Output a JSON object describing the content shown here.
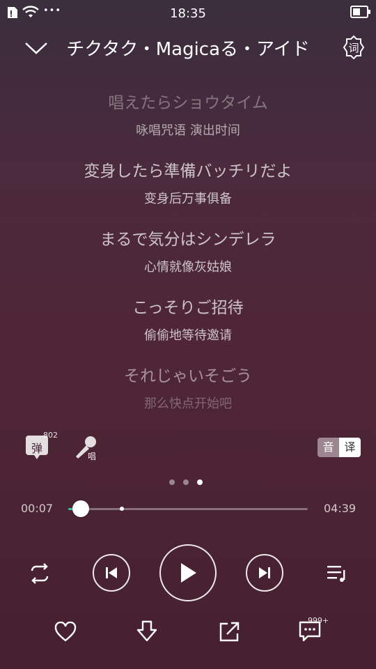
{
  "status_bar": {
    "time": "18:35",
    "more": "•••",
    "icons": [
      "sim-icon",
      "wifi-icon",
      "battery-icon"
    ]
  },
  "header": {
    "title": "チクタク・Magicaる・アイド",
    "settings_glyph": "词",
    "icons": [
      "chevron-down-icon",
      "lyrics-settings-icon"
    ]
  },
  "lyrics": [
    {
      "jp": "唱えたらショウタイム",
      "cn": "咏唱咒语 演出时间",
      "jp_opacity": 0.35,
      "cn_opacity": 0.6
    },
    {
      "jp": "変身したら準備バッチリだよ",
      "cn": "变身后万事俱备",
      "jp_opacity": 0.72,
      "cn_opacity": 0.72
    },
    {
      "jp": "まるで気分はシンデレラ",
      "cn": "心情就像灰姑娘",
      "jp_opacity": 0.72,
      "cn_opacity": 0.72
    },
    {
      "jp": "こっそりご招待",
      "cn": "偷偷地等待邀请",
      "jp_opacity": 0.72,
      "cn_opacity": 0.72
    },
    {
      "jp": "それじゃいそごう",
      "cn": "那么快点开始吧",
      "jp_opacity": 0.5,
      "cn_opacity": 0.3
    }
  ],
  "tools": {
    "danmaku_label": "弹",
    "danmaku_count": "802",
    "sing_label": "唱",
    "toggle_original": "音",
    "toggle_translation": "译",
    "page_index": 3,
    "page_count": 3
  },
  "progress": {
    "current": "00:07",
    "total": "04:39",
    "played_fraction": 0.025,
    "buffered_fraction": 0.225
  },
  "controls": {
    "icons": [
      "repeat-icon",
      "previous-icon",
      "play-icon",
      "next-icon",
      "playlist-icon"
    ]
  },
  "bottom_bar": {
    "comment_count": "999+",
    "icons": [
      "heart-icon",
      "download-icon",
      "share-icon",
      "comment-icon"
    ]
  },
  "colors": {
    "accent": "#35c3a3",
    "background_top": "#3a2e3d",
    "background_bottom": "#46202f"
  }
}
